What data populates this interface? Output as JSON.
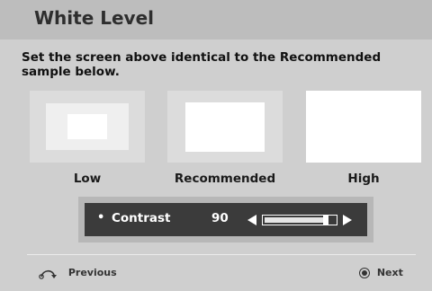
{
  "header": {
    "title": "White Level"
  },
  "instruction": "Set the screen above identical to the Recommended sample below.",
  "samples": [
    {
      "label": "Low"
    },
    {
      "label": "Recommended"
    },
    {
      "label": "High"
    }
  ],
  "control": {
    "bullet": "•",
    "name": "Contrast",
    "value": "90",
    "level": 0.9,
    "left_icon": "triangle-left-icon",
    "right_icon": "triangle-right-icon"
  },
  "footer": {
    "previous": {
      "label": "Previous",
      "icon": "return-icon"
    },
    "next": {
      "label": "Next",
      "icon": "circle-button-icon"
    }
  },
  "colors": {
    "panel": "#cfcfcf",
    "title_bar": "#bdbdbd",
    "control_bg": "#3b3b3b"
  }
}
